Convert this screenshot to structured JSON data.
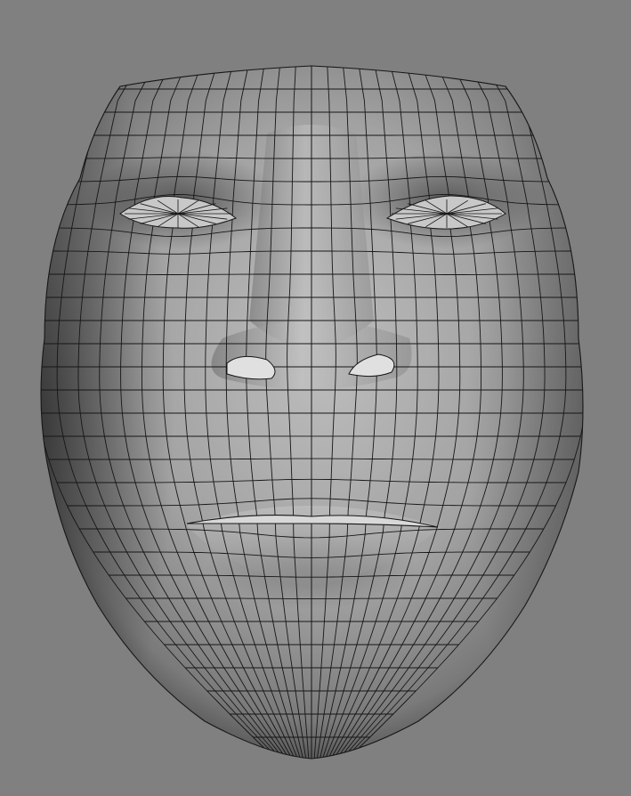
{
  "viewport": {
    "subject": "face-mesh",
    "background_color": "#808080",
    "surface_color": "#9c9c9c",
    "wire_color": "#161616",
    "shading": "smooth-shaded-with-wireframe",
    "view": "front"
  }
}
